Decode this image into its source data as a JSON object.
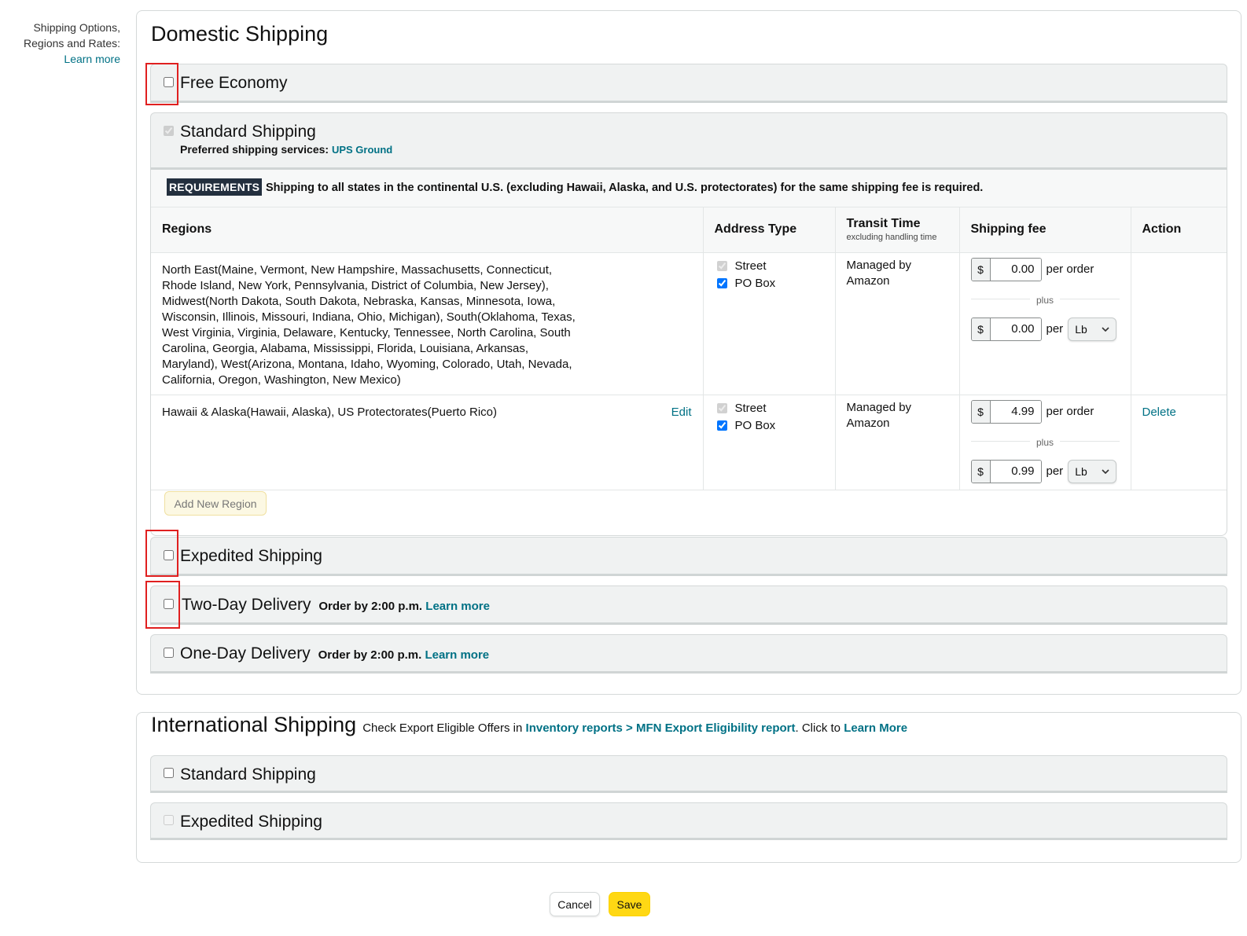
{
  "sidebar": {
    "label_line1": "Shipping Options,",
    "label_line2": "Regions and Rates:",
    "learn_more": "Learn more"
  },
  "domestic": {
    "title": "Domestic Shipping",
    "options": {
      "free_economy": {
        "label": "Free Economy",
        "checked": false
      },
      "standard": {
        "label": "Standard Shipping",
        "checked": true,
        "pref_label": "Preferred shipping services:",
        "pref_value": "UPS Ground",
        "requirements_badge": "REQUIREMENTS",
        "requirements_text": "Shipping to all states in the continental U.S. (excluding Hawaii, Alaska, and U.S. protectorates) for the same shipping fee is required.",
        "table": {
          "headers": {
            "regions": "Regions",
            "address_type": "Address Type",
            "transit_time": "Transit Time",
            "transit_sub": "excluding handling time",
            "shipping_fee": "Shipping fee",
            "action": "Action"
          },
          "rows": [
            {
              "regions": "North East(Maine, Vermont, New Hampshire, Massachusetts, Connecticut, Rhode Island, New York, Pennsylvania, District of Columbia, New Jersey), Midwest(North Dakota, South Dakota, Nebraska, Kansas, Minnesota, Iowa, Wisconsin, Illinois, Missouri, Indiana, Ohio, Michigan), South(Oklahoma, Texas, West Virginia, Virginia, Delaware, Kentucky, Tennessee, North Carolina, South Carolina, Georgia, Alabama, Mississippi, Florida, Louisiana, Arkansas, Maryland), West(Arizona, Montana, Idaho, Wyoming, Colorado, Utah, Nevada, California, Oregon, Washington, New Mexico)",
              "edit": "",
              "street": "Street",
              "po_box": "PO Box",
              "transit": "Managed by Amazon",
              "currency": "$",
              "per_order_fee": "0.00",
              "per_order_label": "per order",
              "plus": "plus",
              "per_unit_fee": "0.00",
              "per_label": "per",
              "unit": "Lb",
              "action": ""
            },
            {
              "regions": "Hawaii & Alaska(Hawaii, Alaska), US Protectorates(Puerto Rico)",
              "edit": "Edit",
              "street": "Street",
              "po_box": "PO Box",
              "transit": "Managed by Amazon",
              "currency": "$",
              "per_order_fee": "4.99",
              "per_order_label": "per order",
              "plus": "plus",
              "per_unit_fee": "0.99",
              "per_label": "per",
              "unit": "Lb",
              "action": "Delete"
            }
          ]
        },
        "add_region": "Add New Region"
      },
      "expedited": {
        "label": "Expedited Shipping",
        "checked": false
      },
      "two_day": {
        "label": "Two-Day Delivery",
        "note": "Order by 2:00 p.m.",
        "learn_more": "Learn more",
        "checked": false
      },
      "one_day": {
        "label": "One-Day Delivery",
        "note": "Order by 2:00 p.m.",
        "learn_more": "Learn more",
        "checked": false
      }
    }
  },
  "international": {
    "title": "International Shipping",
    "note_prefix": "Check Export Eligible Offers in",
    "note_link": "Inventory reports > MFN Export Eligibility report",
    "note_mid": ". Click to",
    "note_learn": "Learn More",
    "options": {
      "standard": {
        "label": "Standard Shipping",
        "checked": false
      },
      "expedited": {
        "label": "Expedited Shipping",
        "checked": false
      }
    }
  },
  "footer": {
    "cancel": "Cancel",
    "save": "Save"
  },
  "colors": {
    "link": "#007185",
    "save_button": "#ffd814",
    "highlight": "#e02020",
    "requirements_badge": "#232f3e"
  }
}
